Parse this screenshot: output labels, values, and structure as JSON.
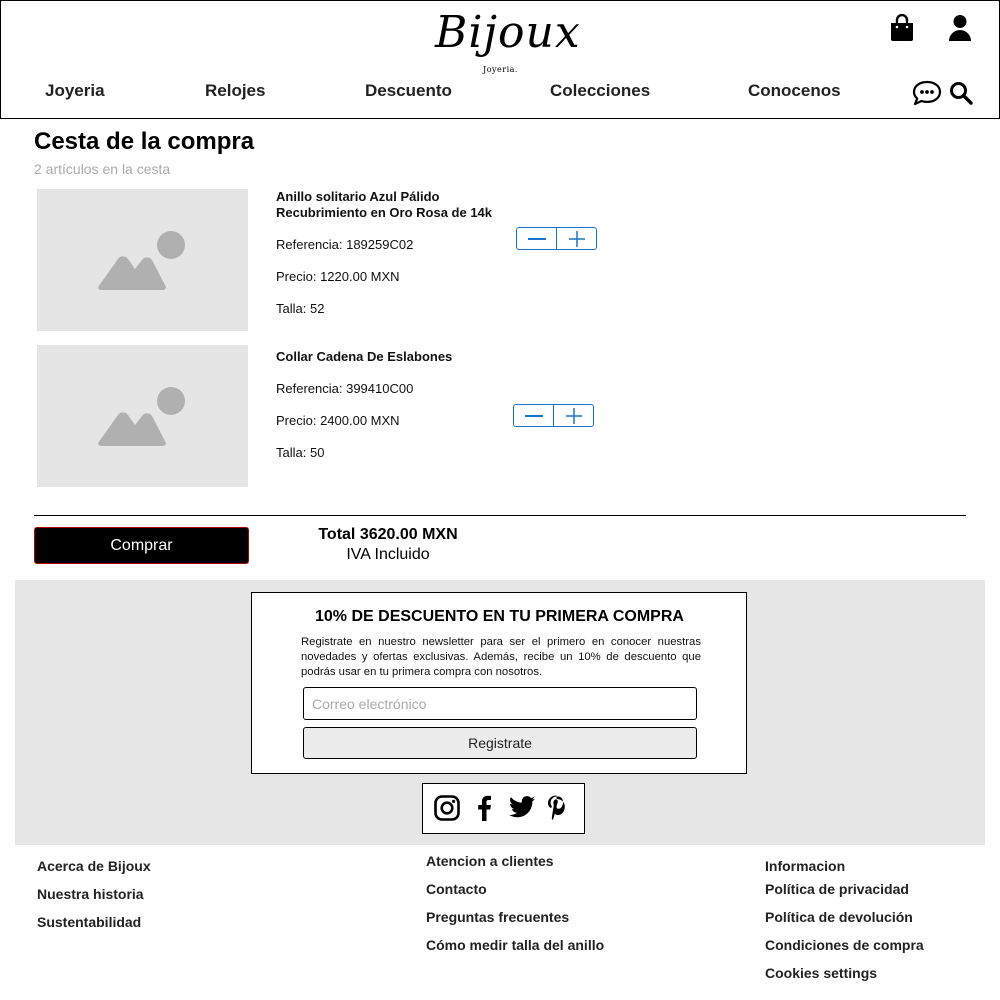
{
  "header": {
    "logo_text": "Bijoux",
    "logo_subtext": "Joyeria.",
    "icons": [
      "shopping-bag-icon",
      "user-icon",
      "chat-icon",
      "search-icon"
    ],
    "nav": [
      "Joyeria",
      "Relojes",
      "Descuento",
      "Colecciones",
      "Conocenos"
    ]
  },
  "cart": {
    "title": "Cesta de la compra",
    "count_text": "2 artículos en la cesta",
    "items": [
      {
        "name_line1": "Anillo solitario Azul Pálido",
        "name_line2": "Recubrimiento en Oro Rosa de 14k",
        "reference": "Referencia: 189259C02",
        "price": "Precio: 1220.00 MXN",
        "size": "Talla: 52"
      },
      {
        "name_line1": "Collar Cadena De Eslabones",
        "reference": "Referencia: 399410C00",
        "price": "Precio: 2400.00 MXN",
        "size": "Talla: 50"
      }
    ],
    "buy_label": "Comprar",
    "total": "Total 3620.00 MXN",
    "tax_note": "IVA Incluido"
  },
  "newsletter": {
    "title": "10% DE DESCUENTO EN TU PRIMERA COMPRA",
    "text": "Registrate en nuestro newsletter para ser el primero en conocer nuestras novedades y ofertas exclusivas. Además, recibe un 10% de descuento que podrás usar en tu primera compra con nosotros.",
    "email_placeholder": "Correo electrónico",
    "button": "Registrate"
  },
  "social": [
    "instagram-icon",
    "facebook-icon",
    "twitter-icon",
    "pinterest-icon"
  ],
  "footer": {
    "col1": [
      "Acerca de Bijoux",
      "Nuestra historia",
      "Sustentabilidad"
    ],
    "col2": [
      "Atencion a clientes",
      "Contacto",
      "Preguntas frecuentes",
      "Cómo medir talla del anillo"
    ],
    "col3": [
      "Informacion",
      "Política de privacidad",
      "Política de devolución",
      "Condiciones de compra",
      "Cookies settings"
    ]
  },
  "colors": {
    "accent_blue": "#1a73c8",
    "image_placeholder": "#e5e5e5",
    "footer_band": "#e6e6e6",
    "buy_button": "#000000"
  }
}
